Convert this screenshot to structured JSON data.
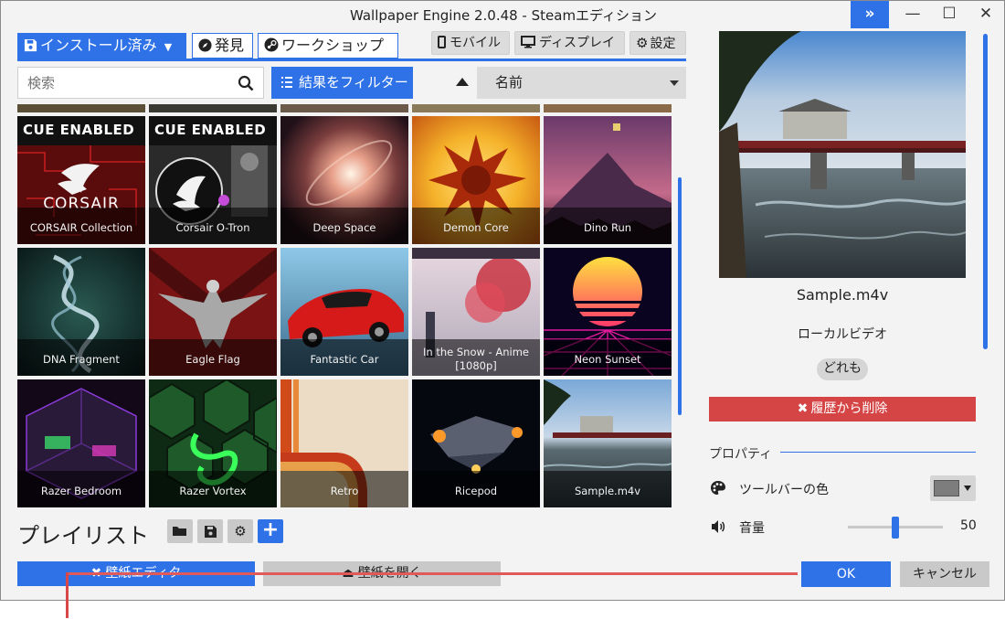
{
  "window": {
    "title": "Wallpaper Engine 2.0.48 - Steamエディション",
    "controls": {
      "expand": "»",
      "minimize": "—",
      "maximize": "☐",
      "close": "✕"
    }
  },
  "nav": {
    "tabs": [
      {
        "label": "インストール済み",
        "icon": "save-icon",
        "active": true,
        "has_dropdown": true
      },
      {
        "label": "発見",
        "icon": "compass-icon",
        "active": false
      },
      {
        "label": "ワークショップ",
        "icon": "steam-icon",
        "active": false
      }
    ],
    "device_buttons": [
      {
        "label": "モバイル",
        "icon": "mobile-icon"
      },
      {
        "label": "ディスプレイ",
        "icon": "monitor-icon"
      },
      {
        "label": "設定",
        "icon": "gear-icon"
      }
    ]
  },
  "search": {
    "placeholder": "検索",
    "filter_label": "結果をフィルター",
    "sort_label": "名前"
  },
  "wallpapers": [
    {
      "title": "CORSAIR Collection",
      "badge": "CUE ENABLED"
    },
    {
      "title": "Corsair O-Tron",
      "badge": "CUE ENABLED"
    },
    {
      "title": "Deep Space"
    },
    {
      "title": "Demon Core"
    },
    {
      "title": "Dino Run"
    },
    {
      "title": "DNA Fragment"
    },
    {
      "title": "Eagle Flag"
    },
    {
      "title": "Fantastic Car"
    },
    {
      "title": "In the Snow - Anime [1080p]"
    },
    {
      "title": "Neon Sunset"
    },
    {
      "title": "Razer Bedroom"
    },
    {
      "title": "Razer Vortex"
    },
    {
      "title": "Retro"
    },
    {
      "title": "Ricepod"
    },
    {
      "title": "Sample.m4v",
      "selected": true
    }
  ],
  "playlist": {
    "label": "プレイリスト"
  },
  "bottom": {
    "editor_label": "壁紙エディタ",
    "open_label": "壁紙を開く",
    "ok_label": "OK",
    "cancel_label": "キャンセル"
  },
  "details": {
    "file_name": "Sample.m4v",
    "file_type": "ローカルビデオ",
    "rating": "どれも",
    "remove_label": "履歴から削除",
    "properties_label": "プロパティ",
    "toolbar_color_label": "ツールバーの色",
    "toolbar_color": "#7d7d7d",
    "volume_label": "音量",
    "volume_value": "50"
  },
  "colors": {
    "accent": "#2f72e8",
    "danger": "#d64545",
    "annotation": "#e05a5a"
  }
}
